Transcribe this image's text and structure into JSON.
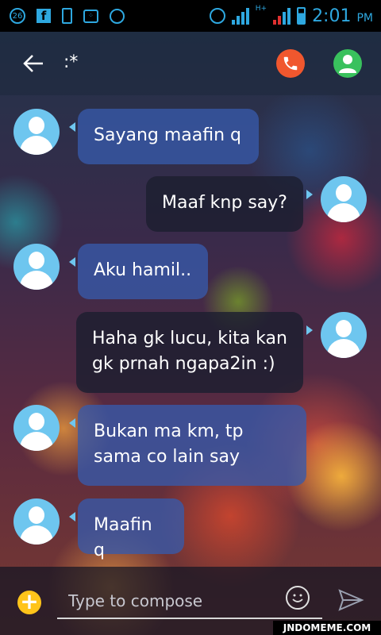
{
  "status_bar": {
    "notification_badge": "26",
    "network_type": "H+",
    "time": "2:01",
    "ampm": "PM",
    "icons": [
      "notification-count-icon",
      "facebook-icon",
      "phone-icon",
      "bbm-icon",
      "whatsapp-icon",
      "alarm-icon",
      "signal-icon",
      "battery-icon"
    ]
  },
  "header": {
    "contact_name": ":*",
    "icons": [
      "back-arrow-icon",
      "call-icon",
      "contact-icon"
    ],
    "call_color": "#f0572e",
    "contact_color": "#39c15d"
  },
  "messages": [
    {
      "direction": "incoming",
      "text": "Sayang maafin q"
    },
    {
      "direction": "outgoing",
      "text": "Maaf knp say?"
    },
    {
      "direction": "incoming",
      "text": "Aku hamil.."
    },
    {
      "direction": "outgoing",
      "text": "Haha gk lucu, kita kan gk prnah ngapa2in :)"
    },
    {
      "direction": "incoming",
      "text": "Bukan ma km, tp sama co lain say"
    },
    {
      "direction": "incoming",
      "text": "Maafin q"
    }
  ],
  "compose": {
    "placeholder": "Type to compose",
    "value": "",
    "icons": [
      "add-icon",
      "emoji-icon",
      "send-icon"
    ]
  },
  "watermark": "JNDOMEME.COM"
}
